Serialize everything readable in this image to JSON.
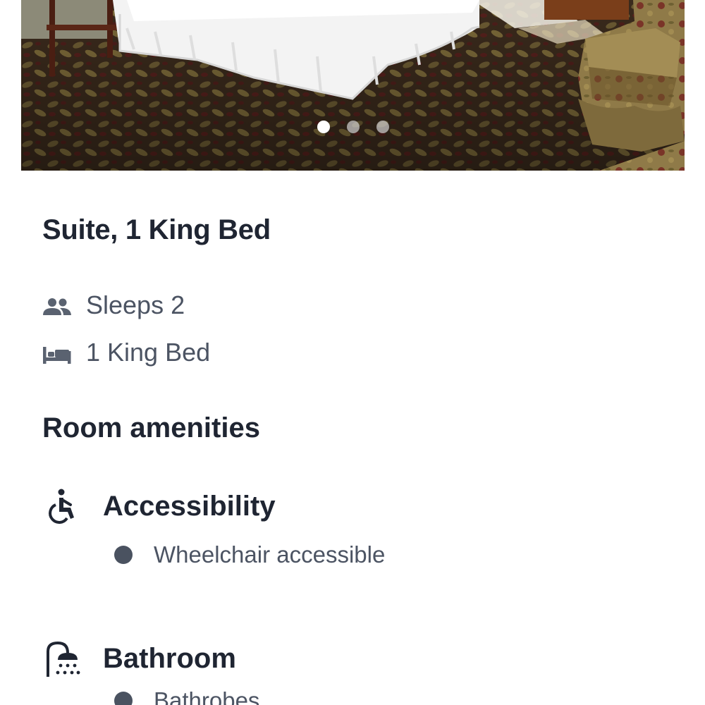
{
  "carousel": {
    "slide_count": 3,
    "active_index": 0
  },
  "room": {
    "title": "Suite, 1 King Bed",
    "sleeps": "Sleeps 2",
    "beds": "1 King Bed"
  },
  "amenities": {
    "section_title": "Room amenities",
    "groups": [
      {
        "title": "Accessibility",
        "icon": "wheelchair-icon",
        "items": [
          "Wheelchair accessible"
        ]
      },
      {
        "title": "Bathroom",
        "icon": "shower-icon",
        "items": [
          "Bathrobes"
        ]
      }
    ]
  },
  "colors": {
    "heading": "#1f2532",
    "body_text": "#4c5463",
    "bullet": "#4a5260"
  }
}
